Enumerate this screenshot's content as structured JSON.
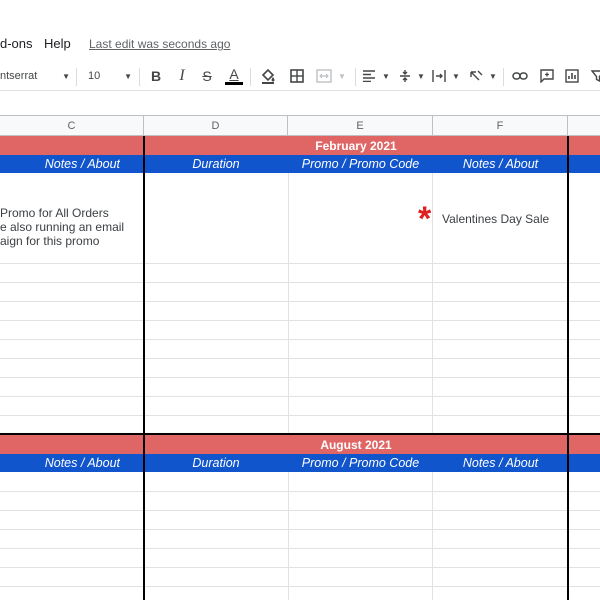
{
  "menu": {
    "addons": "d-ons",
    "help": "Help",
    "last_edit": "Last edit was seconds ago"
  },
  "toolbar": {
    "font_name": "ntserrat",
    "font_size": "10",
    "bold": "B",
    "italic": "I",
    "strike": "S",
    "text_color": "A",
    "icons": [
      "fill-color-icon",
      "borders-icon",
      "merge-icon",
      "align-left-icon",
      "valign-icon",
      "wrap-icon",
      "rotate-icon",
      "link-icon",
      "comment-icon",
      "chart-icon",
      "filter-icon"
    ]
  },
  "columns": [
    "C",
    "D",
    "E",
    "F"
  ],
  "sections": [
    {
      "month": "February 2021",
      "headers": [
        "Notes / About",
        "Duration",
        "Promo / Promo Code",
        "Notes / About"
      ],
      "notes_c": [
        "Promo for All Orders",
        "e also running an email",
        "aign for this promo"
      ],
      "notes_f": "Valentines Day Sale"
    },
    {
      "month": "August 2021",
      "headers": [
        "Notes / About",
        "Duration",
        "Promo / Promo Code",
        "Notes / About"
      ]
    }
  ],
  "colors": {
    "month_bar": "#e06666",
    "header_row": "#1155cc",
    "asterisk": "#e02020"
  }
}
